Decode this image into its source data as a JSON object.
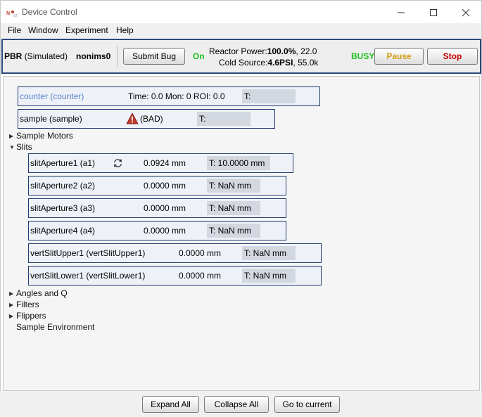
{
  "window": {
    "title": "Device Control"
  },
  "menu": [
    "File",
    "Window",
    "Experiment",
    "Help"
  ],
  "toolbar": {
    "instrument": "PBR",
    "instrument_mode": "(Simulated)",
    "user": "nonims0",
    "submit_bug": "Submit Bug",
    "on_label": "On",
    "reactor_label": "Reactor Power:",
    "reactor_value": "100.0%",
    "reactor_extra": ", 22.0",
    "cold_label": "Cold Source:",
    "cold_value": "4.6PSI",
    "cold_extra": ", 55.0k",
    "busy_label": "BUSY",
    "pause_label": "Pause",
    "stop_label": "Stop",
    "colors": {
      "on": "#1fbf1f",
      "busy": "#1fbf1f",
      "pause": "#d4a017",
      "stop": "#cc0000",
      "panel_border": "#1f3a6e"
    }
  },
  "devices": {
    "counter": {
      "label": "counter (counter)",
      "status": "Time: 0.0 Mon: 0 ROI: 0.0",
      "target": "T:"
    },
    "sample": {
      "label": "sample (sample)",
      "status": "(BAD)",
      "target": "T:",
      "icon": "warning-icon"
    }
  },
  "tree": {
    "sample_motors": "Sample Motors",
    "slits": "Slits",
    "angles": "Angles and Q",
    "filters": "Filters",
    "flippers": "Flippers",
    "sample_env": "Sample Environment"
  },
  "slits": [
    {
      "label": "slitAperture1 (a1)",
      "value": "0.0924 mm",
      "target": "T: 10.0000 mm",
      "icon": "refresh-icon"
    },
    {
      "label": "slitAperture2 (a2)",
      "value": "0.0000 mm",
      "target": "T: NaN mm"
    },
    {
      "label": "slitAperture3 (a3)",
      "value": "0.0000 mm",
      "target": "T: NaN mm"
    },
    {
      "label": "slitAperture4 (a4)",
      "value": "0.0000 mm",
      "target": "T: NaN mm"
    },
    {
      "label": "vertSlitUpper1 (vertSlitUpper1)",
      "value": "0.0000 mm",
      "target": "T: NaN mm"
    },
    {
      "label": "vertSlitLower1 (vertSlitLower1)",
      "value": "0.0000 mm",
      "target": "T: NaN mm"
    }
  ],
  "footer": {
    "expand_all": "Expand All",
    "collapse_all": "Collapse All",
    "go_to_current": "Go to current"
  }
}
